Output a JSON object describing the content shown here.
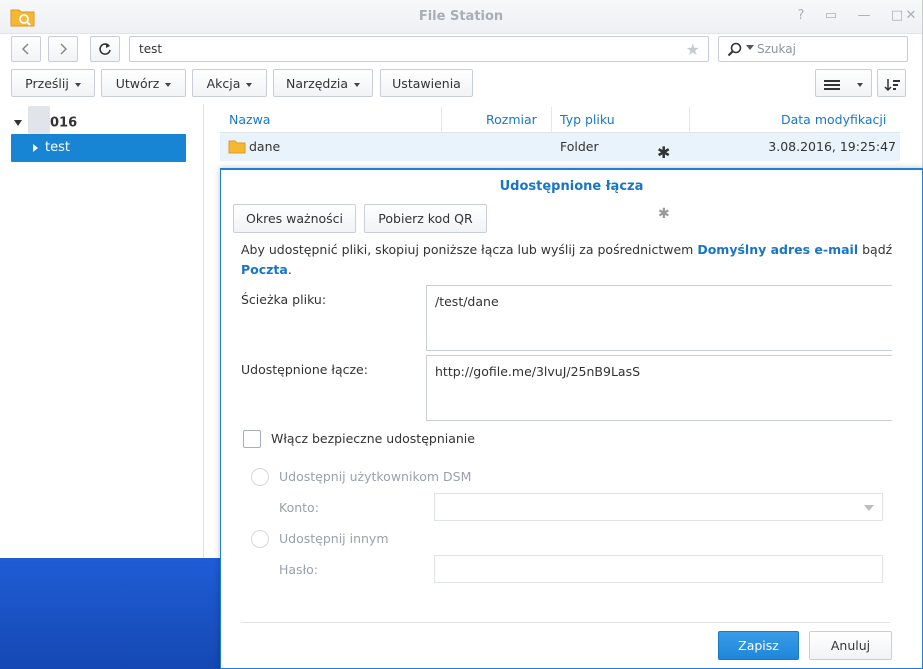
{
  "window": {
    "title": "File Station",
    "controls": [
      "help-icon",
      "pin-icon",
      "minimize-icon",
      "maximize-icon",
      "close-icon"
    ]
  },
  "nav": {
    "path": "test",
    "search_placeholder": "Szukaj"
  },
  "toolbar": {
    "upload": "Prześlij",
    "create": "Utwórz",
    "action": "Akcja",
    "tools": "Narzędzia",
    "settings": "Ustawienia"
  },
  "tree": {
    "root": "016",
    "selected": "test"
  },
  "filelist": {
    "columns": {
      "name": "Nazwa",
      "size": "Rozmiar",
      "type": "Typ pliku",
      "modified": "Data modyfikacji"
    },
    "rows": [
      {
        "name": "dane",
        "size": "",
        "type": "Folder",
        "modified": "3.08.2016, 19:25:47"
      }
    ]
  },
  "dialog": {
    "title": "Udostępnione łącza",
    "validity_button": "Okres ważności",
    "qr_button": "Pobierz kod QR",
    "info_prefix": "Aby udostępnić pliki, skopiuj poniższe łącza lub wyślij za pośrednictwem",
    "info_link1": "Domyślny adres e-mail",
    "info_mid": "bądź",
    "info_link2": "Poczta",
    "info_suffix": ".",
    "path_label": "Ścieżka pliku:",
    "path_value": "/test/dane",
    "link_label": "Udostępnione łącze:",
    "link_value": "http://gofile.me/3lvuJ/25nB9LasS",
    "secure_label": "Włącz bezpieczne udostępnianie",
    "dsm_label": "Udostępnij użytkownikom DSM",
    "account_label": "Konto:",
    "others_label": "Udostępnij innym",
    "password_label": "Hasło:",
    "save": "Zapisz",
    "cancel": "Anuluj"
  },
  "colors": {
    "accent": "#1784d4",
    "title": "#1875c7",
    "desktop": "#1d55c9"
  }
}
